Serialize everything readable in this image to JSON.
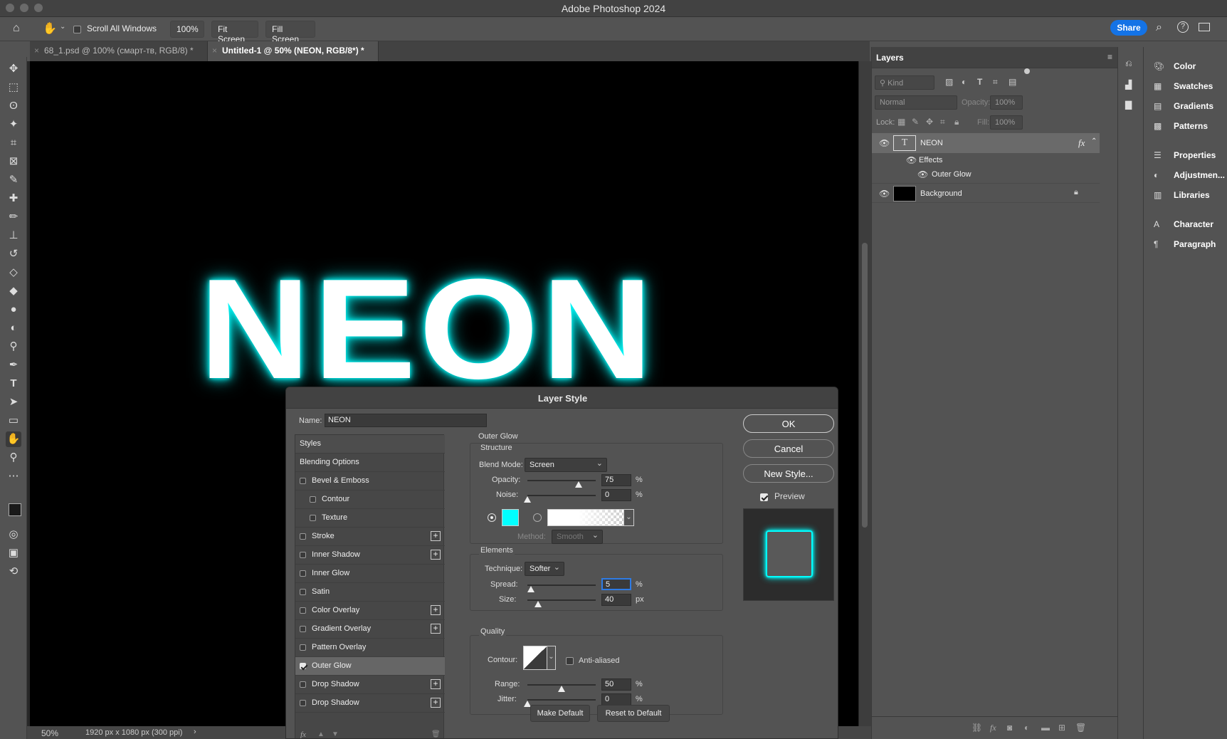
{
  "app": {
    "title": "Adobe Photoshop 2024"
  },
  "options_bar": {
    "scroll_all_windows": "Scroll All Windows",
    "zoom_btn": "100%",
    "fit_screen": "Fit Screen",
    "fill_screen": "Fill Screen",
    "share": "Share"
  },
  "doc_tabs": [
    {
      "label": "68_1.psd @ 100% (смарт-тв, RGB/8) *"
    },
    {
      "label": "Untitled-1 @ 50% (NEON, RGB/8*) *"
    }
  ],
  "canvas": {
    "text": "NEON",
    "glow_color": "#00ffff"
  },
  "status": {
    "zoom": "50%",
    "doc_info": "1920 px x 1080 px (300 ppi)",
    "arrow": "›"
  },
  "layers": {
    "tab": "Layers",
    "kind_placeholder": "Kind",
    "blend": "Normal",
    "opacity_label": "Opacity:",
    "opacity_value": "100%",
    "lock_label": "Lock:",
    "fill_label": "Fill:",
    "fill_value": "100%",
    "items": [
      {
        "name": "NEON",
        "fx": "fx",
        "effects": "Effects",
        "effect": "Outer Glow"
      },
      {
        "name": "Background"
      }
    ]
  },
  "right_panels": [
    "Color",
    "Swatches",
    "Gradients",
    "Patterns",
    "Properties",
    "Adjustmen...",
    "Libraries",
    "Character",
    "Paragraph"
  ],
  "dialog": {
    "title": "Layer Style",
    "name_label": "Name:",
    "name_value": "NEON",
    "styles_header": "Styles",
    "style_items": [
      {
        "label": "Blending Options",
        "checkbox": false,
        "plus": false,
        "indent": 0,
        "checked": false
      },
      {
        "label": "Bevel & Emboss",
        "checkbox": true,
        "plus": false,
        "indent": 0,
        "checked": false
      },
      {
        "label": "Contour",
        "checkbox": true,
        "plus": false,
        "indent": 1,
        "checked": false
      },
      {
        "label": "Texture",
        "checkbox": true,
        "plus": false,
        "indent": 1,
        "checked": false
      },
      {
        "label": "Stroke",
        "checkbox": true,
        "plus": true,
        "indent": 0,
        "checked": false
      },
      {
        "label": "Inner Shadow",
        "checkbox": true,
        "plus": true,
        "indent": 0,
        "checked": false
      },
      {
        "label": "Inner Glow",
        "checkbox": true,
        "plus": false,
        "indent": 0,
        "checked": false
      },
      {
        "label": "Satin",
        "checkbox": true,
        "plus": false,
        "indent": 0,
        "checked": false
      },
      {
        "label": "Color Overlay",
        "checkbox": true,
        "plus": true,
        "indent": 0,
        "checked": false
      },
      {
        "label": "Gradient Overlay",
        "checkbox": true,
        "plus": true,
        "indent": 0,
        "checked": false
      },
      {
        "label": "Pattern Overlay",
        "checkbox": true,
        "plus": false,
        "indent": 0,
        "checked": false
      },
      {
        "label": "Outer Glow",
        "checkbox": true,
        "plus": false,
        "indent": 0,
        "checked": true
      },
      {
        "label": "Drop Shadow",
        "checkbox": true,
        "plus": true,
        "indent": 0,
        "checked": false
      },
      {
        "label": "Drop Shadow",
        "checkbox": true,
        "plus": true,
        "indent": 0,
        "checked": false
      }
    ],
    "section_title": "Outer Glow",
    "structure": {
      "title": "Structure",
      "blend_mode_label": "Blend Mode:",
      "blend_mode": "Screen",
      "opacity_label": "Opacity:",
      "opacity": "75",
      "noise_label": "Noise:",
      "noise": "0",
      "pct": "%",
      "glow_color": "#00ffff",
      "method_label": "Method:",
      "method": "Smooth",
      "opacity_frac": 0.75,
      "noise_frac": 0.0
    },
    "elements": {
      "title": "Elements",
      "technique_label": "Technique:",
      "technique": "Softer",
      "spread_label": "Spread:",
      "spread": "5",
      "size_label": "Size:",
      "size": "40",
      "px": "px",
      "pct": "%",
      "spread_frac": 0.05,
      "size_frac": 0.16
    },
    "quality": {
      "title": "Quality",
      "contour_label": "Contour:",
      "anti_aliased": "Anti-aliased",
      "range_label": "Range:",
      "range": "50",
      "jitter_label": "Jitter:",
      "jitter": "0",
      "pct": "%",
      "range_frac": 0.5,
      "jitter_frac": 0.0
    },
    "make_default": "Make Default",
    "reset_default": "Reset to Default",
    "ok": "OK",
    "cancel": "Cancel",
    "new_style": "New Style...",
    "preview_label": "Preview",
    "fx_icon": "fx"
  }
}
